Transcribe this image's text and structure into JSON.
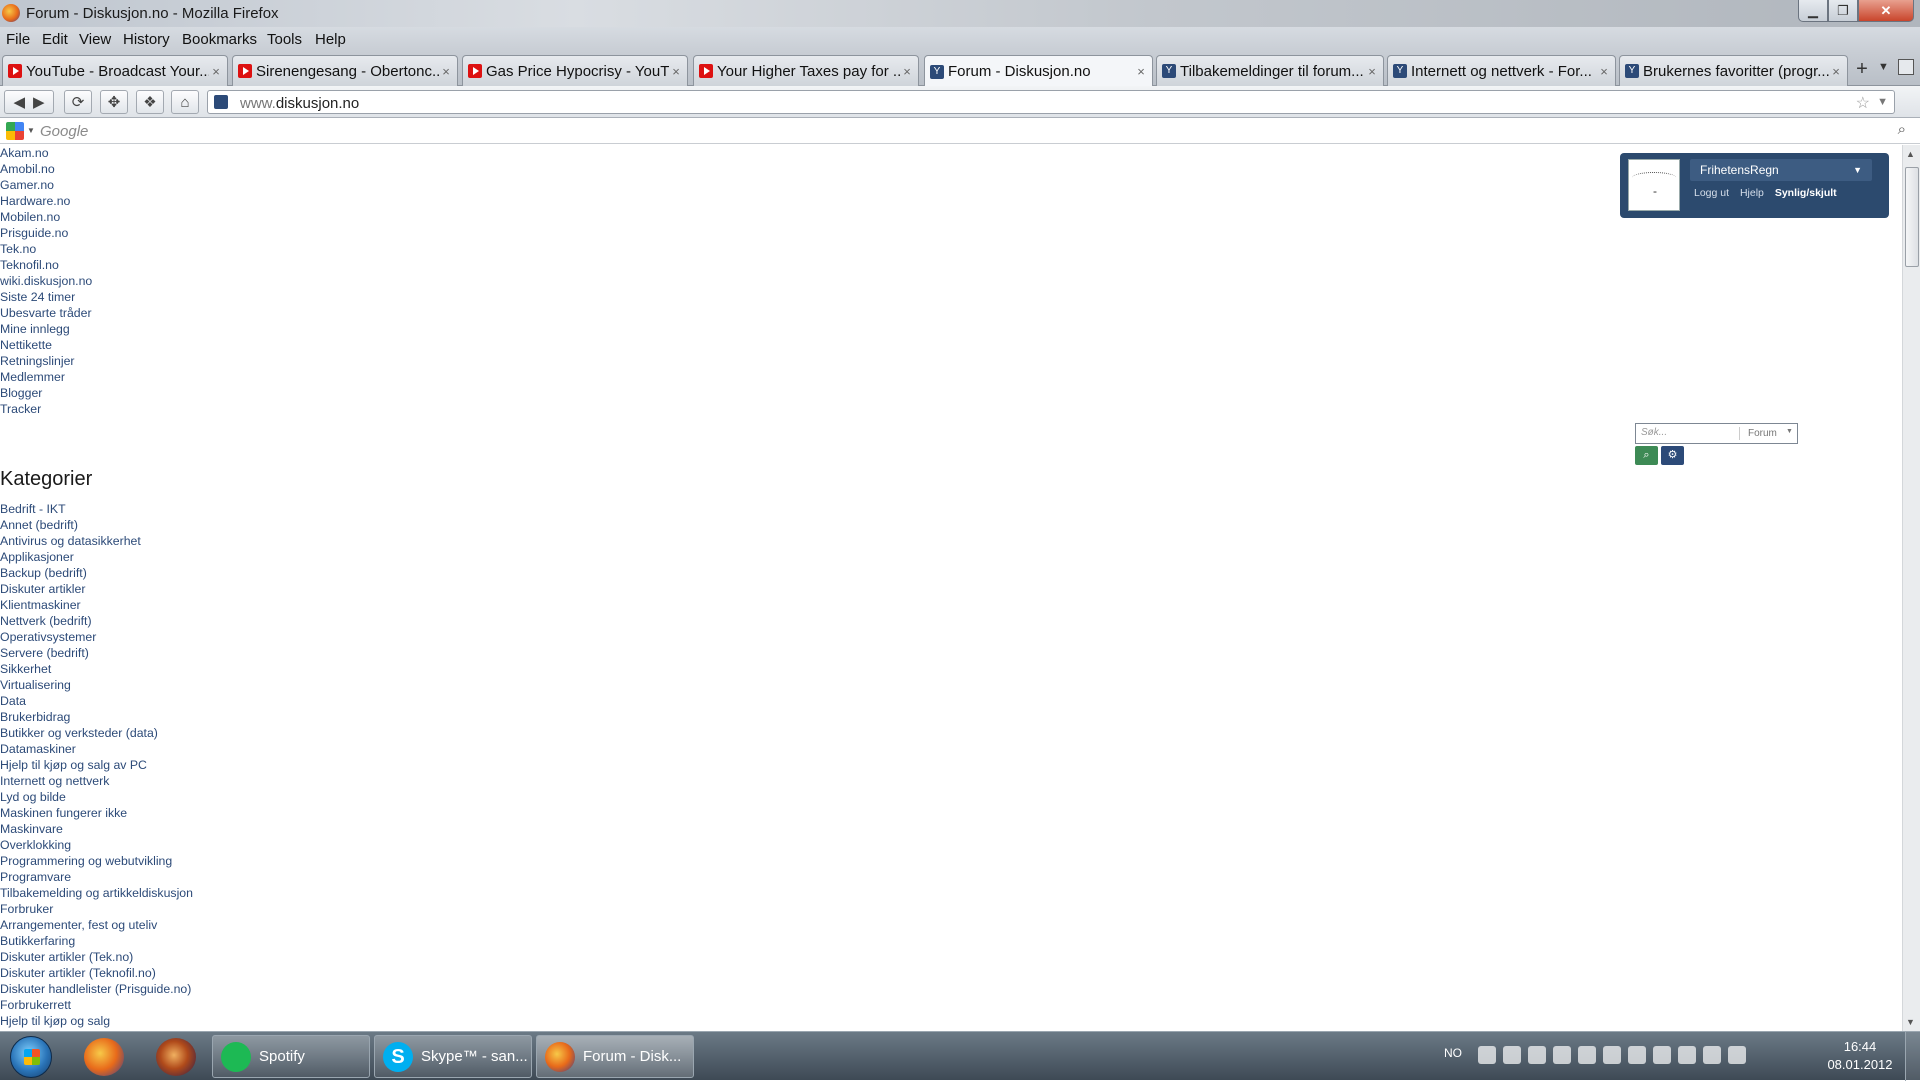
{
  "window": {
    "title": "Forum - Diskusjon.no - Mozilla Firefox"
  },
  "menu": [
    "File",
    "Edit",
    "View",
    "History",
    "Bookmarks",
    "Tools",
    "Help"
  ],
  "tabs": [
    {
      "label": "YouTube - Broadcast Your...",
      "icon": "youtube-icon"
    },
    {
      "label": "Sirenengesang - Obertonc...",
      "icon": "youtube-icon"
    },
    {
      "label": "Gas Price Hypocrisy - YouT...",
      "icon": "youtube-icon"
    },
    {
      "label": "Your Higher Taxes pay for ...",
      "icon": "youtube-icon"
    },
    {
      "label": "Forum - Diskusjon.no",
      "icon": "diskusjon-icon",
      "active": true
    },
    {
      "label": "Tilbakemeldinger til forum...",
      "icon": "diskusjon-icon"
    },
    {
      "label": "Internett og nettverk - For...",
      "icon": "diskusjon-icon"
    },
    {
      "label": "Brukernes favoritter (progr...",
      "icon": "diskusjon-icon"
    }
  ],
  "tab_close_glyph": "×",
  "new_tab_glyph": "+",
  "address": {
    "prefix": "www.",
    "domain": "diskusjon.no"
  },
  "google_bar": {
    "placeholder": "Google"
  },
  "top_links": [
    "Akam.no",
    "Amobil.no",
    "Gamer.no",
    "Hardware.no",
    "Mobilen.no",
    "Prisguide.no",
    "Tek.no",
    "Teknofil.no",
    "wiki.diskusjon.no",
    "Siste 24 timer",
    "Ubesvarte tråder",
    "Mine innlegg",
    "Nettikette",
    "Retningslinjer",
    "Medlemmer",
    "Blogger",
    "Tracker"
  ],
  "categories_heading": "Kategorier",
  "categories": [
    "Bedrift - IKT",
    "Annet (bedrift)",
    "Antivirus og datasikkerhet",
    "Applikasjoner",
    "Backup (bedrift)",
    "Diskuter artikler",
    "Klientmaskiner",
    "Nettverk (bedrift)",
    "Operativsystemer",
    "Servere (bedrift)",
    "Sikkerhet",
    "Virtualisering",
    "Data",
    "Brukerbidrag",
    "Butikker og verksteder (data)",
    "Datamaskiner",
    "Hjelp til kjøp og salg av PC",
    "Internett og nettverk",
    "Lyd og bilde",
    "Maskinen fungerer ikke",
    "Maskinvare",
    "Overklokking",
    "Programmering og webutvikling",
    "Programvare",
    "Tilbakemelding og artikkeldiskusjon",
    "Forbruker",
    "Arrangementer, fest og uteliv",
    "Butikkerfaring",
    "Diskuter artikler (Tek.no)",
    "Diskuter artikler (Teknofil.no)",
    "Diskuter handlelister (Prisguide.no)",
    "Forbrukerrett",
    "Hjelp til kjøp og salg"
  ],
  "user_panel": {
    "username": "FrihetensRegn",
    "logout": "Logg ut",
    "help": "Hjelp",
    "visibility": "Synlig/skjult"
  },
  "forum_search": {
    "placeholder": "Søk...",
    "scope": "Forum"
  },
  "taskbar": {
    "tasks": [
      {
        "label": "Spotify",
        "icon": "spotify-icon"
      },
      {
        "label": "Skype™ - san...",
        "icon": "skype-icon"
      },
      {
        "label": "Forum - Disk...",
        "icon": "firefox-icon",
        "active": true
      }
    ],
    "language": "NO",
    "time": "16:44",
    "date": "08.01.2012"
  },
  "colors": {
    "link": "#2c4a78",
    "user_panel_bg": "#2c4a6e",
    "search_go": "#3d8a55"
  }
}
